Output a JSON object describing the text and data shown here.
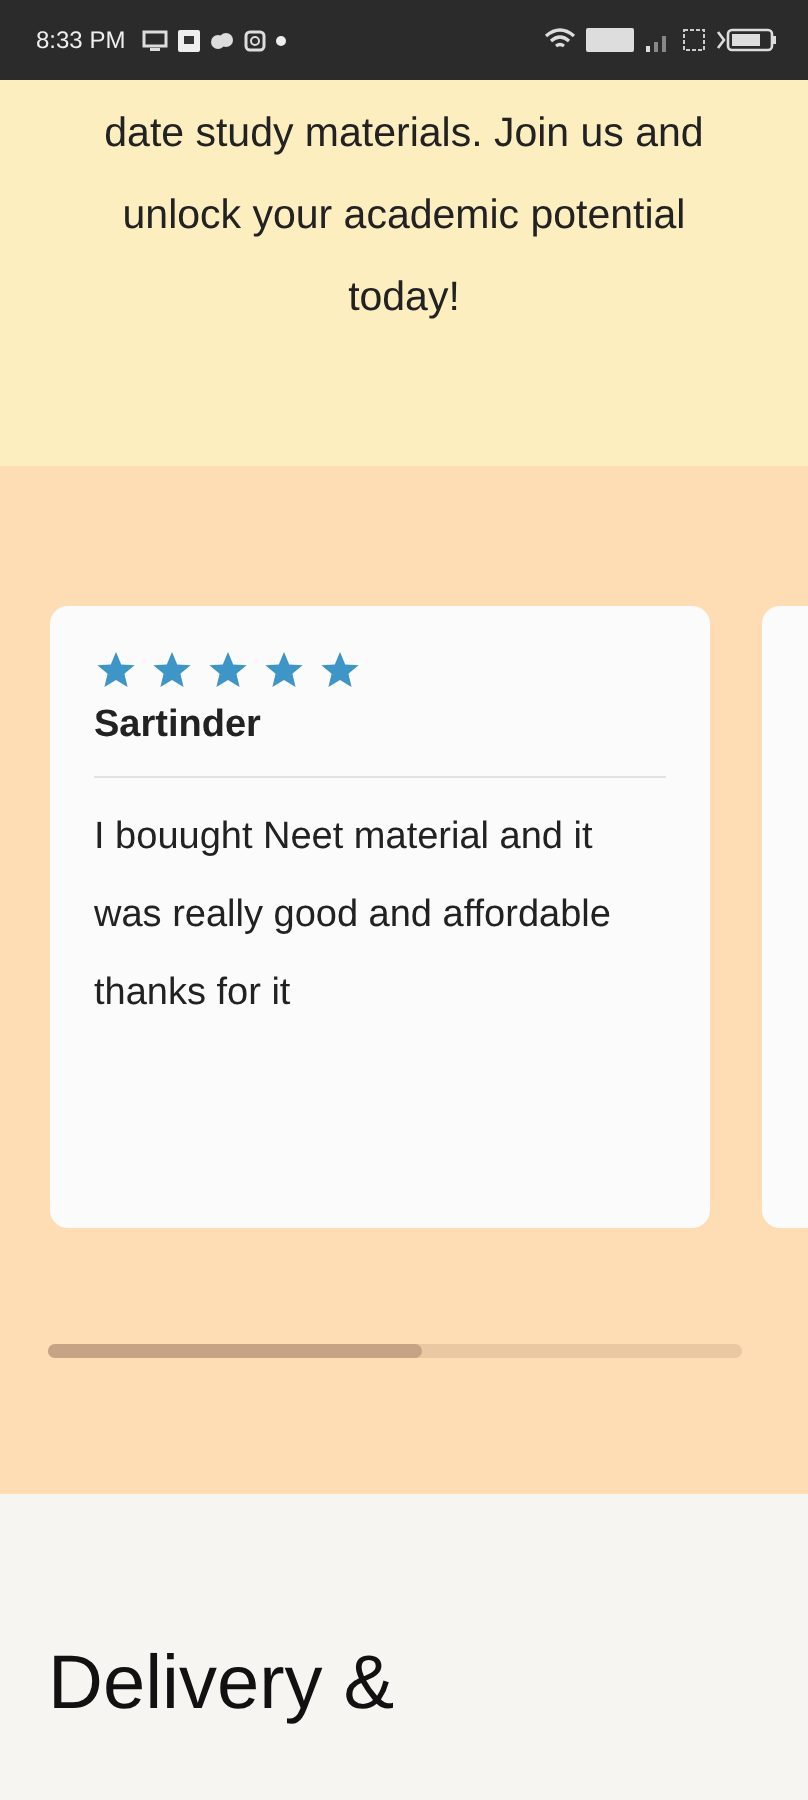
{
  "status_bar": {
    "time": "8:33 PM"
  },
  "intro": {
    "text": "date study materials. Join us and unlock your academic potential today!"
  },
  "reviews": [
    {
      "stars": 5,
      "name": "Sartinder",
      "text": "I bouught Neet material and it was really good and affordable thanks for it"
    }
  ],
  "carousel": {
    "level": 0.54
  },
  "section": {
    "heading": "Delivery &"
  }
}
